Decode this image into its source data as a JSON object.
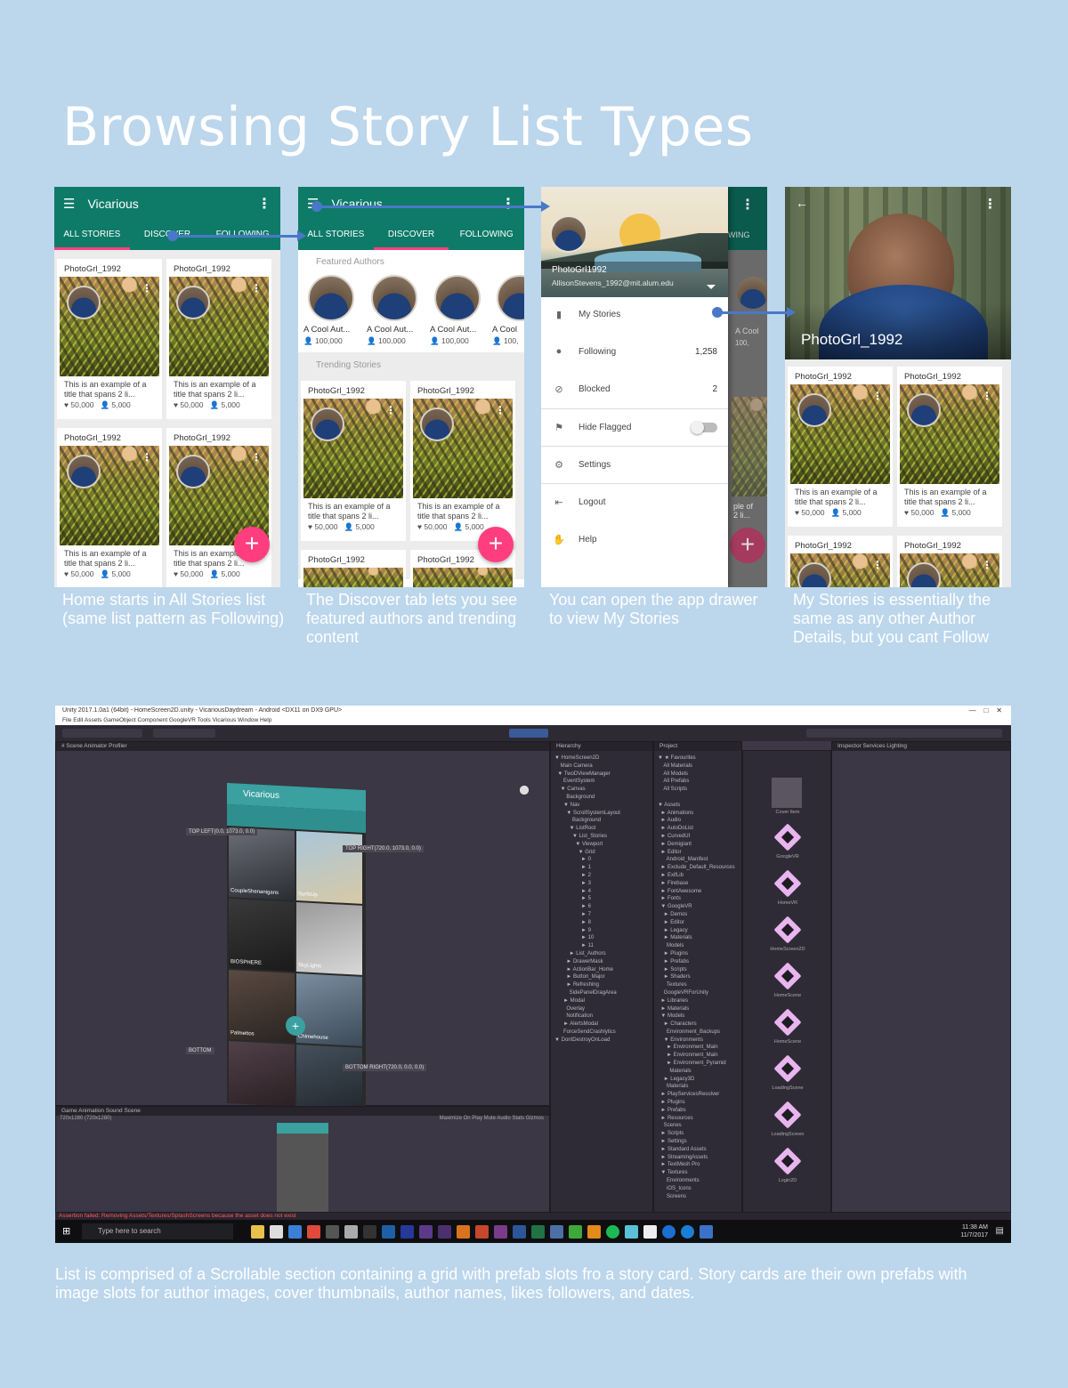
{
  "page": {
    "title": "Browsing Story List Types"
  },
  "app": {
    "name": "Vicarious",
    "tabs": [
      "ALL STORIES",
      "DISCOVER",
      "FOLLOWING"
    ]
  },
  "card": {
    "author": "PhotoGrl_1992",
    "story": "This is an example of a title that spans 2 li...",
    "likes": "50,000",
    "followers": "5,000"
  },
  "discover": {
    "featured_heading": "Featured Authors",
    "trending_heading": "Trending Stories",
    "author_name": "A Cool Aut...",
    "author_name_cut": "A Cool",
    "author_followers": "100,000",
    "author_followers_cut": "100,"
  },
  "drawer": {
    "username": "PhotoGrl1992",
    "email": "AllisonStevens_1992@mit.alum.edu",
    "items": [
      {
        "label": "My Stories",
        "count": "",
        "icon": "book-icon"
      },
      {
        "label": "Following",
        "count": "1,258",
        "icon": "person-icon"
      },
      {
        "label": "Blocked",
        "count": "2",
        "icon": "block-icon"
      },
      {
        "label": "Hide Flagged",
        "count": "",
        "icon": "flag-icon"
      },
      {
        "label": "Settings",
        "count": "",
        "icon": "gear-icon"
      },
      {
        "label": "Logout",
        "count": "",
        "icon": "logout-icon"
      },
      {
        "label": "Help",
        "count": "",
        "icon": "hand-icon"
      }
    ],
    "behind_tab": "WING",
    "behind_author": "A Cool",
    "behind_followers": "100,",
    "behind_story": "ple of\n2 li..."
  },
  "mystories": {
    "profile_name": "PhotoGrl_1992"
  },
  "captions": [
    "Home starts in All Stories list (same list pattern as Following)",
    "The Discover tab lets you see featured authors and trending content",
    "You can open the app drawer to view My Stories",
    "My Stories is essentially the same as any other Author Details, but you cant Follow"
  ],
  "unity": {
    "window_title": "Unity 2017.1.0a1 (64bit) - HomeScreen2D.unity - VicariousDaydream - Android <DX11 on DX9 GPU>",
    "menu": "File   Edit   Assets   GameObject   Component   GoogleVR   Tools   Vicarious   Window   Help",
    "scene_tabs": "# Scene     Animator     Profiler",
    "hierarchy_tab": "Hierarchy",
    "project_tab": "Project",
    "inspector_tabs": "Inspector     Services     Lighting",
    "hierarchy_tree": "▼ HomeScreen2D\n    Main Camera\n  ▼ TwoDViewManager\n      EventSystem\n    ▼ Canvas\n        Background\n      ▼ Nav\n        ▼ ScrollSystemLayout\n            Background\n          ▼ ListRoot\n            ▼ List_Stories\n              ▼ Viewport\n                ▼ Grid\n                  ► 0\n                  ► 1\n                  ► 2\n                  ► 3\n                  ► 4\n                  ► 5\n                  ► 6\n                  ► 7\n                  ► 8\n                  ► 9\n                  ► 10\n                  ► 11\n          ► List_Authors\n        ► DrawerMask\n        ► ActionBar_Home\n        ► Button_Major\n        ► Refreshing\n          SidePanelDragArea\n      ► Modal\n        Overlay\n        Notification\n      ► AlertsModal\n      ForceSendCrashlytics\n▼ DontDestroyOnLoad",
    "project_tree": "▼ ★ Favourites\n    All Materials\n    All Models\n    All Prefabs\n    All Scripts\n\n▼ Assets\n  ► Animations\n  ► Audio\n  ► AutoDoList\n  ► CurvedUI\n  ► Demigiant\n  ► Editor\n      Android_Manifest\n  ► Exclude_Default_Resources\n  ► ExifLib\n  ► Firebase\n  ► FontAwesome\n  ► Fonts\n  ▼ GoogleVR\n    ► Demos\n    ► Editor\n    ► Legacy\n    ► Materials\n      Models\n    ► Plugins\n    ► Prefabs\n    ► Scripts\n    ► Shaders\n      Textures\n    GoogleVRForUnity\n  ► Libraries\n  ► Materials\n  ▼ Models\n    ► Characters\n      Environment_Backups\n    ▼ Environments\n      ► Environment_Main\n      ► Environment_Main\n      ► Environment_Pyramid\n        Materials\n    ► Legacy3D\n      Materials\n  ► PlayServicesResolver\n  ► Plugins\n  ► Prefabs\n  ► Resources\n    Scenes\n  ► Scripts\n  ► Settings\n  ► Standard Assets\n  ► StreamingAssets\n  ► TextMesh Pro\n  ▼ Textures\n      Environments\n      iOS_Icons\n      Screens",
    "asset_labels": [
      "Cover Item",
      "GoogleVR",
      "HomeVR",
      "HomeScreen2D",
      "HomeScene",
      "HomeScene",
      "LoadingScene",
      "LoadingScreen",
      "Login2D"
    ],
    "anchor_labels": [
      "TOP LEFT(0.0, 1073.0, 0.0)",
      "TOP RIGHT(720.0, 1073.0, 0.0)",
      "BOTTOM",
      "BOTTOM RIGHT(720.0, 0.0, 0.0)"
    ],
    "game_tabs": "Game     Animation     Sound Scene",
    "game_resolution": "720x1280 (720x1280)",
    "game_options": "Maximize On Play   Mute Audio   Stats   Gizmos",
    "error_text": "Assertion failed: Removing Assets/Textures/SplashScreens because the asset does not exist",
    "taskbar_search": "Type here to search",
    "clock_time": "11:38 AM",
    "clock_date": "11/7/2017",
    "scene_cards": [
      "CoupleShenanigans",
      "SurfsUp",
      "BIOSPHERE",
      "SkyLights",
      "Palmettos",
      "Chimehouse"
    ]
  },
  "bottom_caption": "List is comprised of a Scrollable section containing a grid with prefab slots fro a story card. Story cards are their own prefabs with image slots for author images, cover thumbnails, author names, likes followers, and dates."
}
